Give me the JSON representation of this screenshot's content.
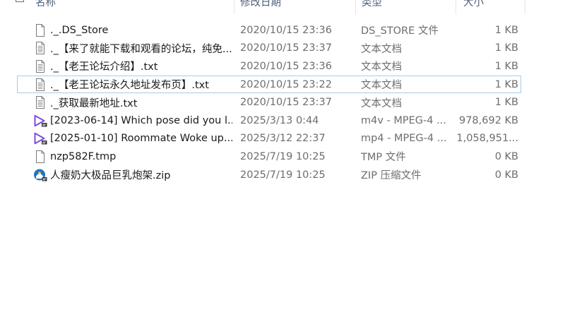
{
  "header": {
    "columns": {
      "name": "名称",
      "date": "修改日期",
      "type": "类型",
      "size": "大小"
    }
  },
  "files": [
    {
      "name": "._.DS_Store",
      "date": "2020/10/15 23:36",
      "type": "DS_STORE 文件",
      "size": "1 KB",
      "icon": "blank-file-icon",
      "focused": false
    },
    {
      "name": "._【来了就能下载和观看的论坛，纯免...",
      "date": "2020/10/15 23:37",
      "type": "文本文档",
      "size": "1 KB",
      "icon": "text-document-icon",
      "focused": false
    },
    {
      "name": "._【老王论坛介绍】.txt",
      "date": "2020/10/15 23:36",
      "type": "文本文档",
      "size": "1 KB",
      "icon": "text-document-icon",
      "focused": false
    },
    {
      "name": "._【老王论坛永久地址发布页】.txt",
      "date": "2020/10/15 23:22",
      "type": "文本文档",
      "size": "1 KB",
      "icon": "text-document-icon",
      "focused": true
    },
    {
      "name": "._获取最新地址.txt",
      "date": "2020/10/15 23:37",
      "type": "文本文档",
      "size": "1 KB",
      "icon": "text-document-icon",
      "focused": false
    },
    {
      "name": "[2023-06-14] Which pose did you l...",
      "date": "2025/3/13 0:44",
      "type": "m4v - MPEG-4 ...",
      "size": "978,692 KB",
      "icon": "video-file-icon",
      "focused": false
    },
    {
      "name": "[2025-01-10] Roommate Woke up...",
      "date": "2025/3/12 22:37",
      "type": "mp4 - MPEG-4 ...",
      "size": "1,058,951...",
      "icon": "video-file-icon",
      "focused": false
    },
    {
      "name": "nzp582F.tmp",
      "date": "2025/7/19 10:25",
      "type": "TMP 文件",
      "size": "0 KB",
      "icon": "blank-file-icon",
      "focused": false
    },
    {
      "name": "人瘦奶大极品巨乳炮架.zip",
      "date": "2025/7/19 10:25",
      "type": "ZIP 压缩文件",
      "size": "0 KB",
      "icon": "zip-file-icon",
      "focused": false
    }
  ],
  "colors": {
    "name_text": "#1a1a1a",
    "detail_text": "#6d6d6d",
    "header_text": "#4c607a",
    "focus_border": "#a8cbe8",
    "video_icon": "#7b4fd8",
    "zip_icon": "#1f72c8"
  }
}
